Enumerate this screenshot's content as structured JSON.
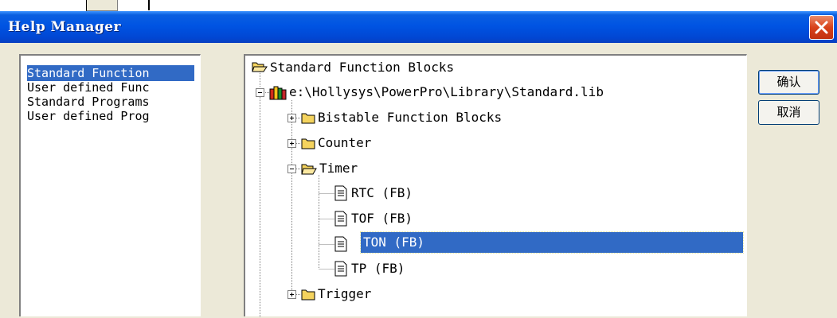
{
  "dialog": {
    "title": "Help Manager"
  },
  "categories": {
    "items": [
      {
        "label": "Standard Function",
        "selected": true
      },
      {
        "label": "User defined Func",
        "selected": false
      },
      {
        "label": "Standard Programs",
        "selected": false
      },
      {
        "label": "User defined Prog",
        "selected": false
      }
    ]
  },
  "tree": {
    "root": "Standard Function Blocks",
    "library": "e:\\Hollysys\\PowerPro\\Library\\Standard.lib",
    "folders": [
      {
        "label": "Bistable Function Blocks",
        "expanded": false
      },
      {
        "label": "Counter",
        "expanded": false
      },
      {
        "label": "Timer",
        "expanded": true
      },
      {
        "label": "Trigger",
        "expanded": false
      }
    ],
    "timer_children": [
      {
        "label": "RTC (FB)",
        "selected": false
      },
      {
        "label": "TOF (FB)",
        "selected": false
      },
      {
        "label": "TON (FB)",
        "selected": true
      },
      {
        "label": "TP (FB)",
        "selected": false
      }
    ]
  },
  "buttons": {
    "ok": "确认",
    "cancel": "取消"
  },
  "colors": {
    "titlebar": "#0054e3",
    "selection": "#316ac5",
    "dialog_bg": "#ece9d8",
    "close": "#d8421a"
  }
}
